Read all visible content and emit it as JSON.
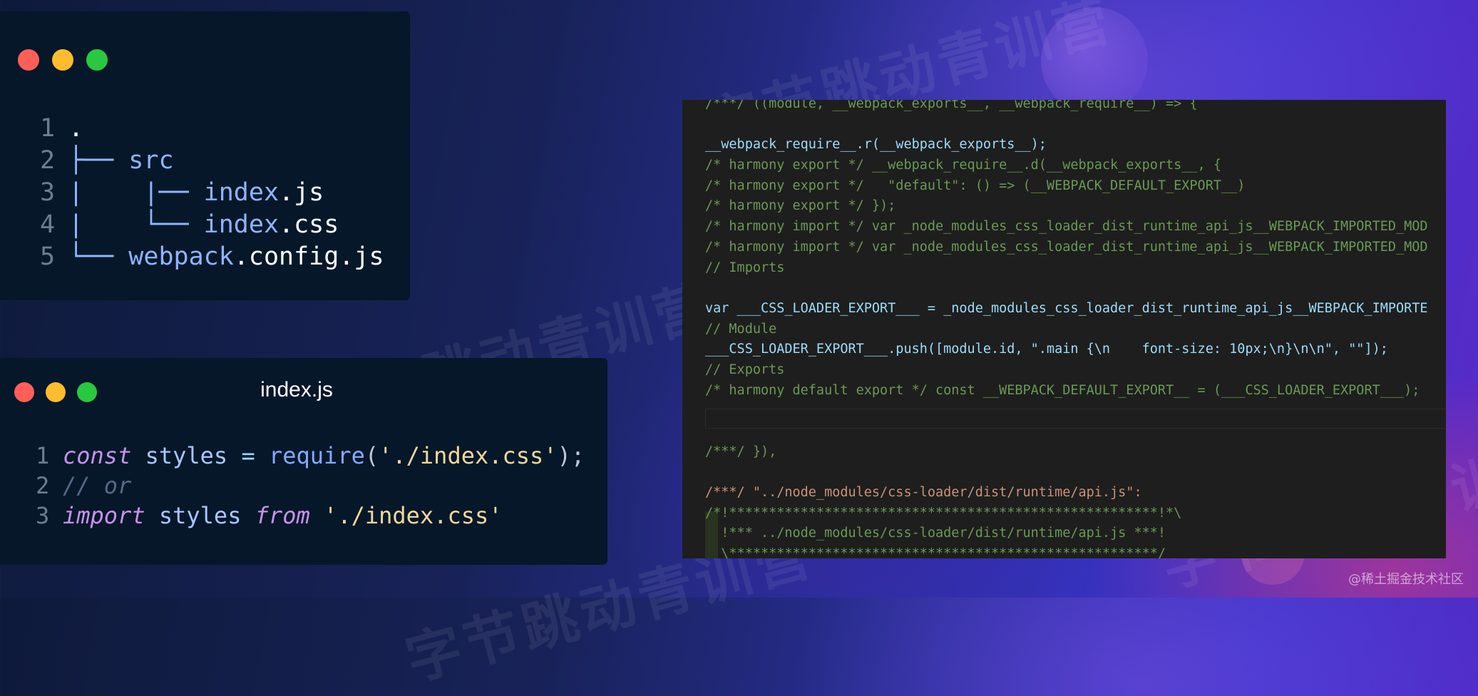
{
  "background_watermark": {
    "text": "字节跳动青训营"
  },
  "tree_window": {
    "lines": [
      {
        "num": "1",
        "branch": "",
        "name": ".",
        "ext": ""
      },
      {
        "num": "2",
        "branch": "├── ",
        "name": "src",
        "ext": ""
      },
      {
        "num": "3",
        "branch": "|    |── ",
        "name": "index",
        "ext": ".js"
      },
      {
        "num": "4",
        "branch": "|    └── ",
        "name": "index",
        "ext": ".css"
      },
      {
        "num": "5",
        "branch": "└── ",
        "name": "webpack",
        "ext": ".config.js"
      }
    ]
  },
  "js_window": {
    "title": "index.js",
    "lines": [
      {
        "num": "1",
        "kw1": "const",
        "rest1": " styles ",
        "op": "=",
        "fn": " require",
        "p1": "(",
        "str": "'./index.css'",
        "p2": ");"
      },
      {
        "num": "2",
        "comment": "// or"
      },
      {
        "num": "3",
        "kw1": "import",
        "rest1": " styles ",
        "kw2": "from",
        "str": " './index.css'"
      }
    ]
  },
  "code_window": {
    "lines": [
      "/***/ ((module, __webpack_exports__, __webpack_require__) => {",
      "",
      "__webpack_require__.r(__webpack_exports__);",
      "/* harmony export */ __webpack_require__.d(__webpack_exports__, {",
      "/* harmony export */   \"default\": () => (__WEBPACK_DEFAULT_EXPORT__)",
      "/* harmony export */ });",
      "/* harmony import */ var _node_modules_css_loader_dist_runtime_api_js__WEBPACK_IMPORTED_MOD",
      "/* harmony import */ var _node_modules_css_loader_dist_runtime_api_js__WEBPACK_IMPORTED_MOD",
      "// Imports",
      "",
      "var ___CSS_LOADER_EXPORT___ = _node_modules_css_loader_dist_runtime_api_js__WEBPACK_IMPORTE",
      "// Module",
      "___CSS_LOADER_EXPORT___.push([module.id, \".main {\\n    font-size: 10px;\\n}\\n\\n\", \"\"]);",
      "// Exports",
      "/* harmony default export */ const __WEBPACK_DEFAULT_EXPORT__ = (___CSS_LOADER_EXPORT___);",
      "",
      "",
      "/***/ }),",
      "",
      "/***/ \"../node_modules/css-loader/dist/runtime/api.js\":",
      "/*!******************************************************!*\\",
      "  !*** ../node_modules/css-loader/dist/runtime/api.js ***!",
      "  \\******************************************************/"
    ]
  },
  "footer": {
    "text": "@稀土掘金技术社区"
  }
}
